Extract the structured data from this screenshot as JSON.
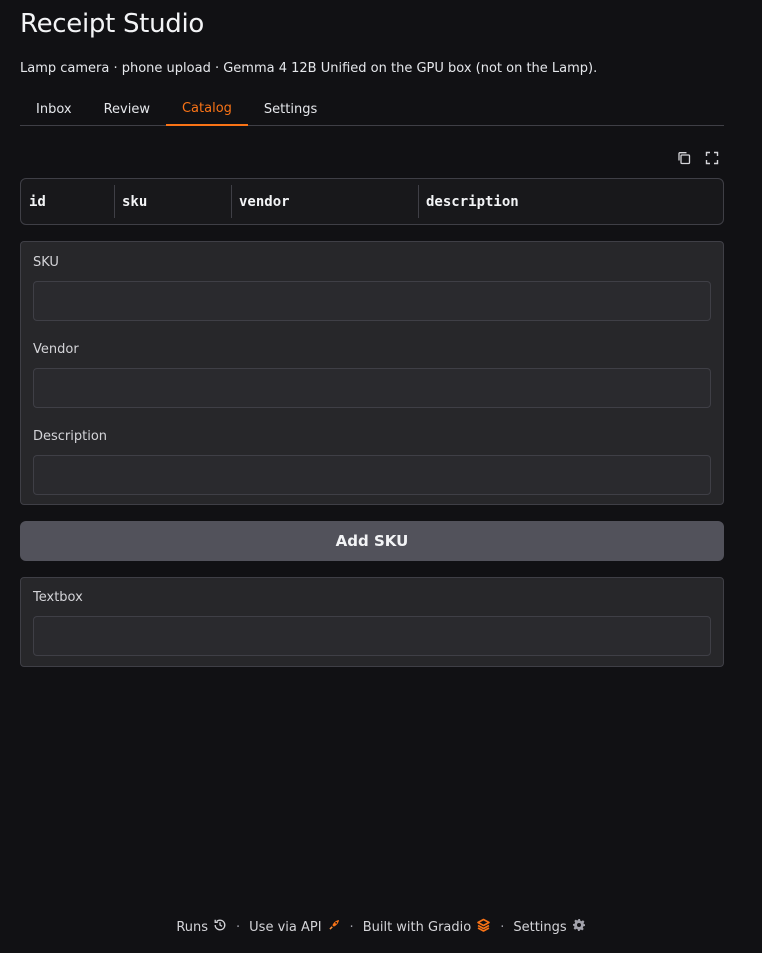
{
  "app": {
    "title": "Receipt Studio",
    "subtitle": "Lamp camera · phone upload · Gemma 4 12B Unified on the GPU box (not on the Lamp)."
  },
  "tabs": [
    {
      "label": "Inbox",
      "active": false
    },
    {
      "label": "Review",
      "active": false
    },
    {
      "label": "Catalog",
      "active": true
    },
    {
      "label": "Settings",
      "active": false
    }
  ],
  "toolbar": {
    "copy_icon": "copy-icon",
    "fullscreen_icon": "fullscreen-icon"
  },
  "table": {
    "columns": [
      "id",
      "sku",
      "vendor",
      "description"
    ]
  },
  "form": {
    "sku": {
      "label": "SKU",
      "value": ""
    },
    "vendor": {
      "label": "Vendor",
      "value": ""
    },
    "description": {
      "label": "Description",
      "value": ""
    }
  },
  "add_button": {
    "label": "Add SKU"
  },
  "output": {
    "label": "Textbox",
    "value": ""
  },
  "footer": {
    "runs": "Runs",
    "api": "Use via API",
    "built": "Built with Gradio",
    "settings": "Settings"
  },
  "colors": {
    "accent": "#f97316",
    "background": "#111114",
    "panel": "#27272a",
    "button": "#52525b"
  }
}
